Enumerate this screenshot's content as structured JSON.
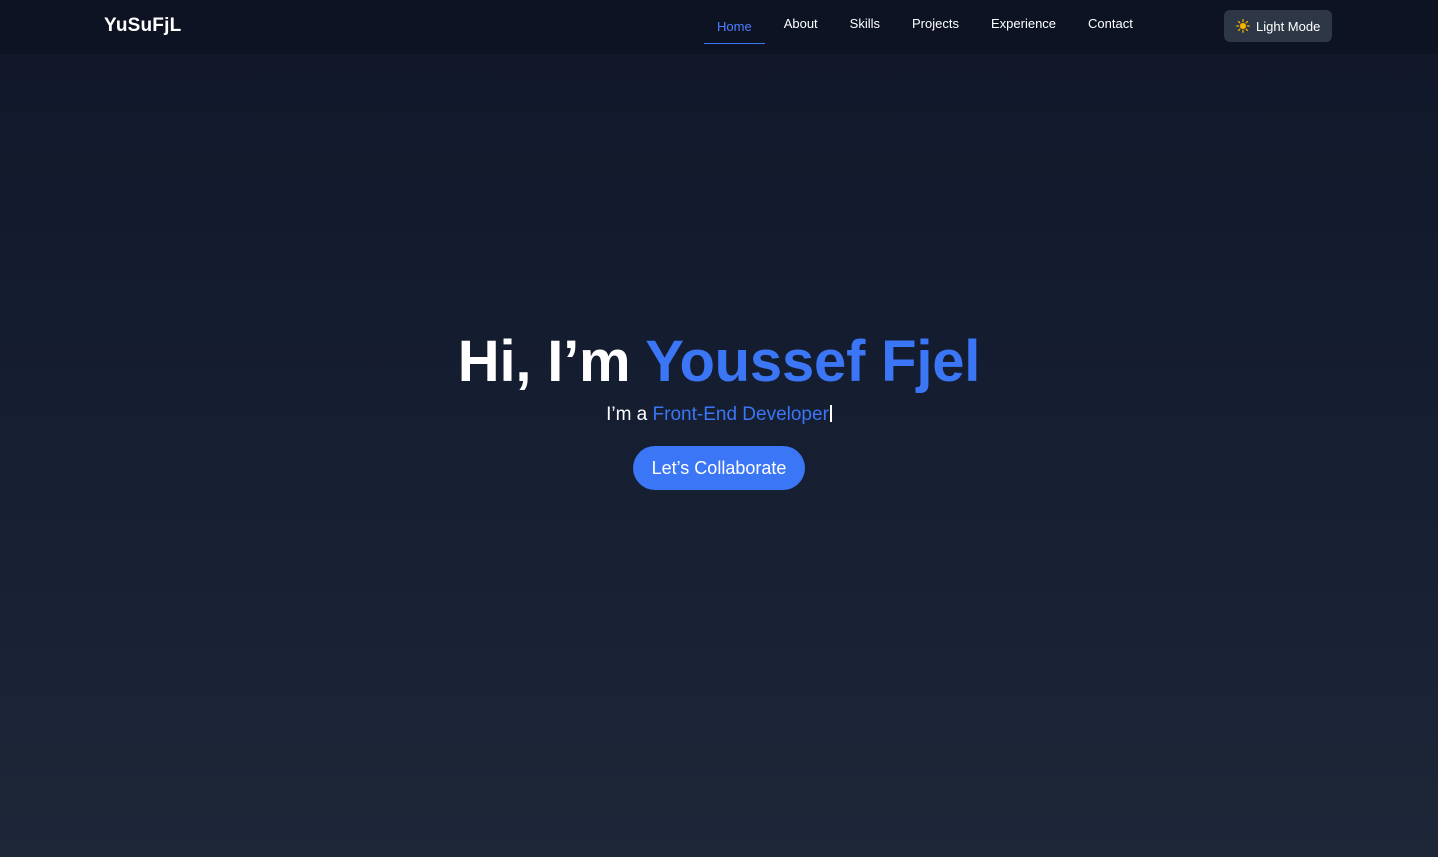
{
  "nav": {
    "logo": "YuSuFjL",
    "links": [
      {
        "label": "Home",
        "active": true
      },
      {
        "label": "About",
        "active": false
      },
      {
        "label": "Skills",
        "active": false
      },
      {
        "label": "Projects",
        "active": false
      },
      {
        "label": "Experience",
        "active": false
      },
      {
        "label": "Contact",
        "active": false
      }
    ],
    "theme_toggle": {
      "icon": "sun-icon",
      "label": "Light Mode"
    }
  },
  "hero": {
    "greeting": "Hi, I’m ",
    "name": "Youssef Fjel",
    "subtitle_prefix": "I’m a ",
    "role": "Front-End Developer",
    "cta_label": "Let’s Collaborate"
  },
  "colors": {
    "accent": "#3b76f6",
    "background_top": "#111729",
    "background_bottom": "#1d2738",
    "toggle_bg": "#2e3746",
    "sun": "#f5b800"
  }
}
